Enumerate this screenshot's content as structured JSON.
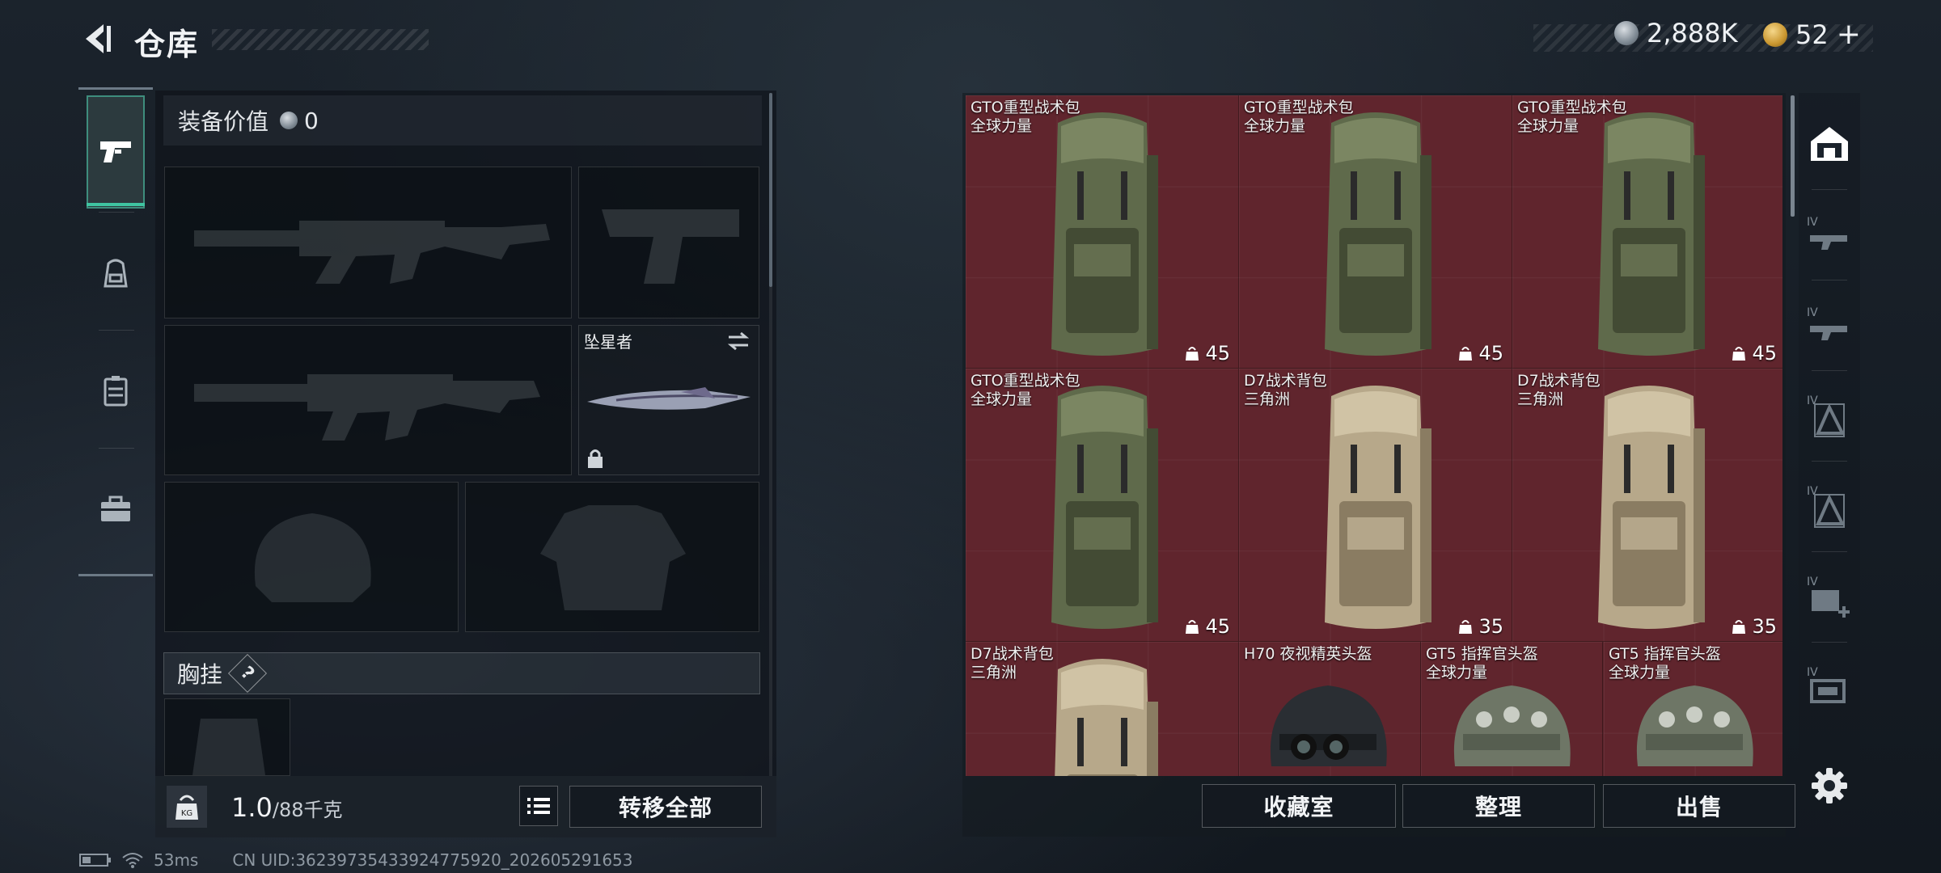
{
  "header": {
    "title": "仓库",
    "silver_amount": "2,888K",
    "gold_amount": "52",
    "gold_plus": "+"
  },
  "left_tabs": [
    {
      "icon": "pistol-icon",
      "active": true
    },
    {
      "icon": "backpack-icon",
      "active": false
    },
    {
      "icon": "vest-icon",
      "active": false
    },
    {
      "icon": "toolbox-icon",
      "active": false
    }
  ],
  "equipment": {
    "value_label": "装备价值",
    "value": "0",
    "melee_name": "坠星者",
    "chest_label": "胸挂",
    "chest_help": "?"
  },
  "bottom": {
    "weight_current": "1.0",
    "weight_capacity": "/88千克",
    "weight_icon_label": "KG",
    "transfer_all": "转移全部"
  },
  "stash": {
    "items": [
      {
        "name": "GTO重型战术包",
        "sub": "全球力量",
        "count": "45",
        "color": "green"
      },
      {
        "name": "GTO重型战术包",
        "sub": "全球力量",
        "count": "45",
        "color": "green"
      },
      {
        "name": "GTO重型战术包",
        "sub": "全球力量",
        "count": "45",
        "color": "green"
      },
      {
        "name": "GTO重型战术包",
        "sub": "全球力量",
        "count": "45",
        "color": "green"
      },
      {
        "name": "D7战术背包",
        "sub": "三角洲",
        "count": "35",
        "color": "tan"
      },
      {
        "name": "D7战术背包",
        "sub": "三角洲",
        "count": "35",
        "color": "tan"
      },
      {
        "name": "D7战术背包",
        "sub": "三角洲",
        "count": "",
        "color": "tan"
      }
    ],
    "helmets": [
      {
        "name": "H70 夜视精英头盔",
        "sub": ""
      },
      {
        "name": "GT5 指挥官头盔",
        "sub": "全球力量"
      },
      {
        "name": "GT5 指挥官头盔",
        "sub": "全球力量"
      }
    ],
    "buttons": {
      "collection": "收藏室",
      "organize": "整理",
      "sell": "出售"
    }
  },
  "right_tabs": [
    "home-icon",
    "tier4-weapon-icon",
    "tier4-weapon-icon",
    "tier4-armor-icon",
    "tier4-armor-icon",
    "tier4-medkit-icon",
    "tier4-ammo-icon"
  ],
  "status": {
    "ping": "53ms",
    "uid": "CN UID:3623973543392477592​0_202605291653"
  },
  "colors": {
    "accent": "#3fc4a1",
    "stash_bg": "#60252d"
  }
}
